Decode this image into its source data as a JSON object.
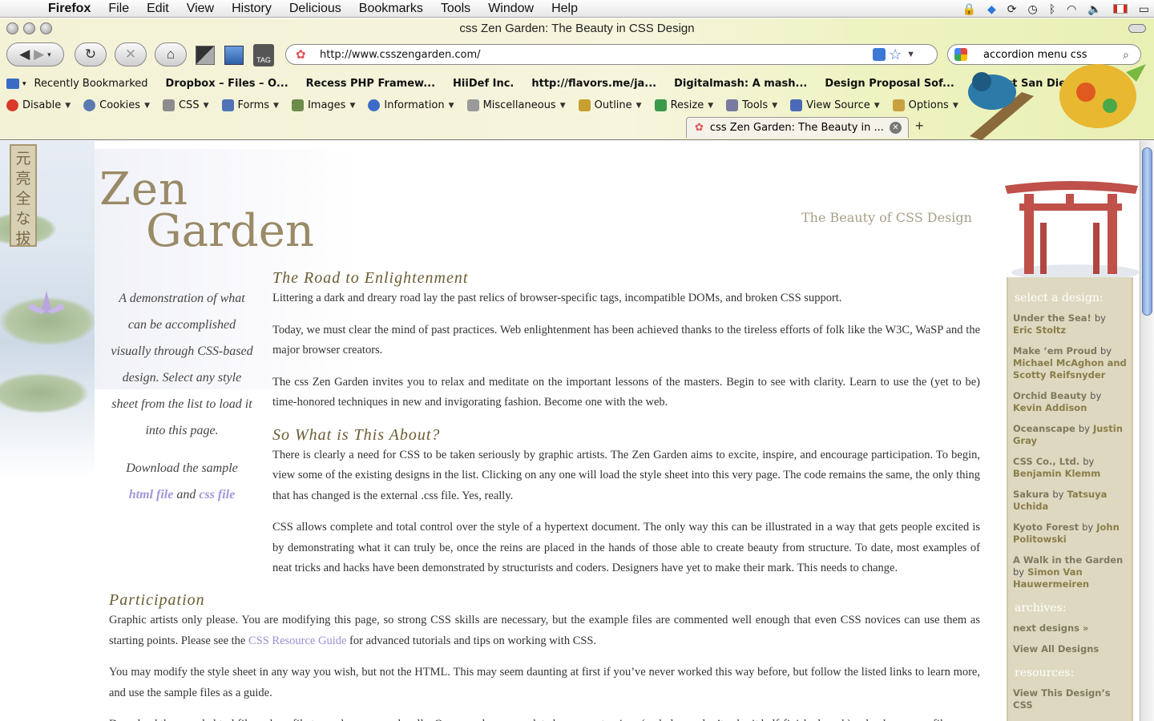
{
  "menubar": {
    "app": "Firefox",
    "items": [
      "File",
      "Edit",
      "View",
      "History",
      "Delicious",
      "Bookmarks",
      "Tools",
      "Window",
      "Help"
    ]
  },
  "window": {
    "title": "css Zen Garden: The Beauty in CSS Design"
  },
  "nav": {
    "url": "http://www.csszengarden.com/",
    "search_value": "accordion menu css"
  },
  "bookmarks": [
    "Recently Bookmarked",
    "Dropbox – Files – O...",
    "Recess PHP Framew...",
    "HiiDef Inc.",
    "http://flavors.me/ja...",
    "Digitalmash: A mash...",
    "Design Proposal Sof...",
    "Contact San Diego W..."
  ],
  "devbar": [
    {
      "label": "Disable",
      "color": "#d93a2a"
    },
    {
      "label": "Cookies",
      "color": "#5a7ab0"
    },
    {
      "label": "CSS",
      "color": "#8c8c8c"
    },
    {
      "label": "Forms",
      "color": "#4f72b8"
    },
    {
      "label": "Images",
      "color": "#6c8c4c"
    },
    {
      "label": "Information",
      "color": "#3c6cc8"
    },
    {
      "label": "Miscellaneous",
      "color": "#9a9a9a"
    },
    {
      "label": "Outline",
      "color": "#c8a030"
    },
    {
      "label": "Resize",
      "color": "#3a9a4a"
    },
    {
      "label": "Tools",
      "color": "#7a7aa0"
    },
    {
      "label": "View Source",
      "color": "#4a6ab8"
    },
    {
      "label": "Options",
      "color": "#c8a040"
    }
  ],
  "tab": {
    "title": "css Zen Garden: The Beauty in ..."
  },
  "page": {
    "logo_line1": "Zen",
    "logo_line2": "Garden",
    "tagline": "The Beauty of CSS Design",
    "stamp": "元亮全な拔",
    "intro": "A demonstration of what can be accomplished visually through CSS-based design. Select any style sheet from the list to load it into this page.",
    "download_prefix": "Download the sample",
    "html_link": "html file",
    "and_word": "and",
    "css_link": "css file",
    "sections": [
      {
        "heading": "The Road to Enlightenment",
        "paragraphs": [
          "Littering a dark and dreary road lay the past relics of browser-specific tags, incompatible DOMs, and broken CSS support.",
          "Today, we must clear the mind of past practices. Web enlightenment has been achieved thanks to the tireless efforts of folk like the W3C, WaSP and the major browser creators.",
          "The css Zen Garden invites you to relax and meditate on the important lessons of the masters. Begin to see with clarity. Learn to use the (yet to be) time-honored techniques in new and invigorating fashion. Become one with the web."
        ]
      },
      {
        "heading": "So What is This About?",
        "paragraphs": [
          "There is clearly a need for CSS to be taken seriously by graphic artists. The Zen Garden aims to excite, inspire, and encourage participation. To begin, view some of the existing designs in the list. Clicking on any one will load the style sheet into this very page. The code remains the same, the only thing that has changed is the external .css file. Yes, really.",
          "CSS allows complete and total control over the style of a hypertext document. The only way this can be illustrated in a way that gets people excited is by demonstrating what it can truly be, once the reins are placed in the hands of those able to create beauty from structure. To date, most examples of neat tricks and hacks have been demonstrated by structurists and coders. Designers have yet to make their mark. This needs to change."
        ]
      }
    ],
    "participation": {
      "heading": "Participation",
      "p1_before": "Graphic artists only please. You are modifying this page, so strong CSS skills are necessary, but the example files are commented well enough that even CSS novices can use them as starting points. Please see the",
      "p1_link": "CSS Resource Guide",
      "p1_after": "for advanced tutorials and tips on working with CSS.",
      "p2": "You may modify the style sheet in any way you wish, but not the HTML. This may seem daunting at first if you’ve never worked this way before, but follow the listed links to learn more, and use the sample files as a guide.",
      "p3": "Download the sample html file and css file to work on a copy locally. Once you have completed your masterpiece (and please, don’t submit half-finished work) upload your .css file"
    }
  },
  "sidebar": {
    "select_heading": "select a design:",
    "designs": [
      {
        "title": "Under the Sea!",
        "author": "Eric Stoltz"
      },
      {
        "title": "Make ’em Proud",
        "author": "Michael McAghon and Scotty Reifsnyder"
      },
      {
        "title": "Orchid Beauty",
        "author": "Kevin Addison"
      },
      {
        "title": "Oceanscape",
        "author": "Justin Gray"
      },
      {
        "title": "CSS Co., Ltd.",
        "author": "Benjamin Klemm"
      },
      {
        "title": "Sakura",
        "author": "Tatsuya Uchida"
      },
      {
        "title": "Kyoto Forest",
        "author": "John Politowski"
      },
      {
        "title": "A Walk in the Garden",
        "author": "Simon Van Hauwermeiren"
      }
    ],
    "by_word": "by",
    "archives_heading": "archives:",
    "next_designs": "next designs »",
    "view_all": "View All Designs",
    "resources_heading": "resources:",
    "view_css": "View This Design’s CSS"
  }
}
